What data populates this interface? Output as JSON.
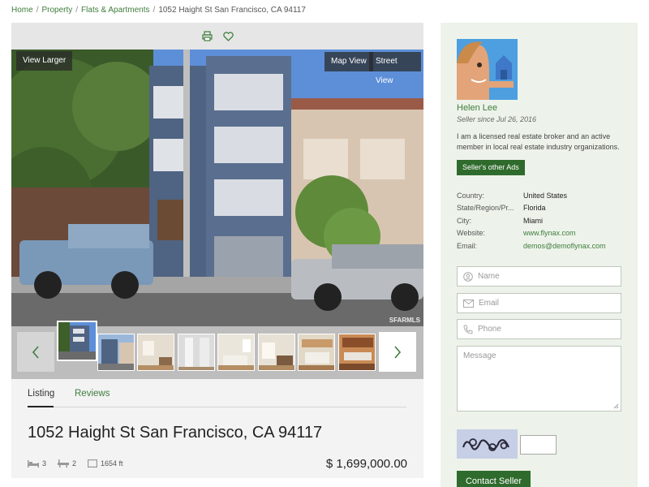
{
  "breadcrumb": {
    "items": [
      "Home",
      "Property",
      "Flats & Apartments"
    ],
    "current": "1052 Haight St San Francisco, CA 94117",
    "separator": "/"
  },
  "photo": {
    "view_larger": "View Larger",
    "map_view": "Map View",
    "street_view": "Street View",
    "watermark": "SFARMLS"
  },
  "tabs": {
    "listing": "Listing",
    "reviews": "Reviews"
  },
  "listing": {
    "title": "1052 Haight St San Francisco, CA 94117",
    "bedrooms": "3",
    "bathrooms": "2",
    "area": "1654 ft",
    "price": "$ 1,699,000.00"
  },
  "seller": {
    "name": "Helen Lee",
    "since": "Seller since Jul 26, 2016",
    "bio": "I am a licensed real estate broker and an active member in local real estate industry organizations.",
    "other_ads": "Seller's other Ads",
    "info": [
      {
        "label": "Country:",
        "value": "United States"
      },
      {
        "label": "State/Region/Pr...",
        "value": "Florida"
      },
      {
        "label": "City:",
        "value": "Miami"
      },
      {
        "label": "Website:",
        "value": "www.flynax.com"
      },
      {
        "label": "Email:",
        "value": "demos@demoflynax.com"
      }
    ]
  },
  "contact_form": {
    "name_placeholder": "Name",
    "email_placeholder": "Email",
    "phone_placeholder": "Phone",
    "message_placeholder": "Message",
    "submit": "Contact Seller"
  },
  "colors": {
    "accent_green": "#3f7d3c",
    "button_green": "#2f6b2c",
    "sidebar_bg": "#edf3ea"
  }
}
